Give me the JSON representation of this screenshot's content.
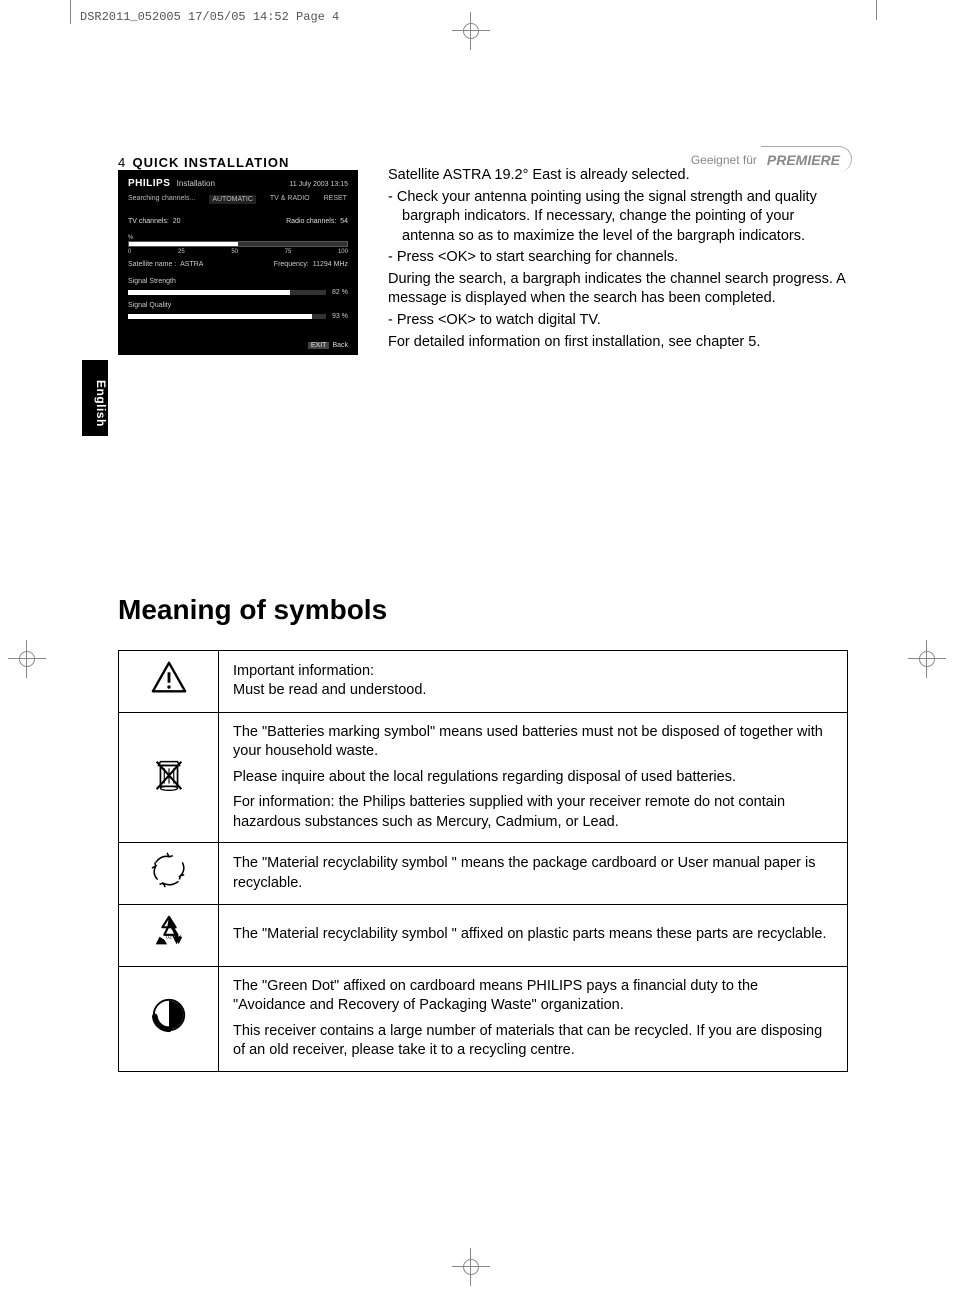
{
  "crop_header": "DSR2011_052005  17/05/05  14:52  Page 4",
  "tv": {
    "brand": "PHILIPS",
    "mode": "Installation",
    "datetime": "11 July 2003   13:15",
    "tabs": {
      "left": "Searching channels...",
      "mid": "AUTOMATIC",
      "right1": "TV & RADIO",
      "right2": "RESET"
    },
    "tv_channels_label": "TV channels:",
    "tv_channels_value": "20",
    "radio_channels_label": "Radio channels:",
    "radio_channels_value": "54",
    "scale_labels": [
      "0",
      "25",
      "50",
      "75",
      "100"
    ],
    "scale_pct": "%",
    "sat_name_label": "Satellite name :",
    "sat_name_value": "ASTRA",
    "freq_label": "Frequency:",
    "freq_value": "11294 MHz",
    "signal_strength_label": "Signal Strength",
    "signal_strength_value": "82 %",
    "signal_quality_label": "Signal Quality",
    "signal_quality_value": "93 %",
    "footer_exit": "EXIT",
    "footer_back": "Back"
  },
  "body": {
    "p1": "Satellite ASTRA 19.2° East is already selected.",
    "b1": "-  Check your antenna pointing using the signal strength and quality bargraph indicators. If necessary, change the pointing of your antenna so as to maximize the level of the bargraph indicators.",
    "b2": "-  Press <OK> to start searching for channels.",
    "p2": "During the search, a bargraph indicates the channel search progress. A message is displayed when the search has been completed.",
    "b3": "-  Press <OK> to watch digital TV.",
    "p3": "For detailed information on first installation, see chapter 5."
  },
  "lang_tab": "English",
  "section_title": "Meaning of symbols",
  "symbols": [
    {
      "icon": "warning",
      "paras": [
        "Important information:\nMust be read and understood."
      ]
    },
    {
      "icon": "crossed-bin",
      "paras": [
        "The \"Batteries marking symbol\" means used batteries must not be disposed of together with your household waste.",
        "Please inquire about the local regulations regarding disposal of used batteries.",
        "For information: the Philips batteries supplied with your receiver remote do not contain hazardous substances such as Mercury, Cadmium, or Lead."
      ]
    },
    {
      "icon": "recycle-arrows",
      "paras": [
        "The \"Material recyclability symbol \" means the package cardboard or User manual paper is recyclable."
      ]
    },
    {
      "icon": "recycle-triangle",
      "paras": [
        "The \"Material recyclability symbol \" affixed on plastic parts means these parts are recyclable."
      ]
    },
    {
      "icon": "green-dot",
      "paras": [
        "The \"Green Dot\" affixed on cardboard means PHILIPS pays a financial duty to the \"Avoidance and Recovery of Packaging Waste\" organization.",
        "This receiver contains a large number of materials that can be recycled. If you are disposing of an old receiver, please take it to a recycling centre."
      ]
    }
  ],
  "footer": {
    "page_num": "4",
    "section": "QUICK INSTALLATION",
    "right_text": "Geeignet für",
    "right_brand": "PREMIERE"
  }
}
